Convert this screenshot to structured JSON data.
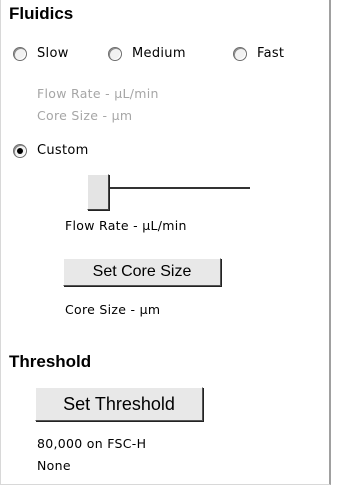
{
  "fluidics": {
    "title": "Fluidics",
    "rate_options": [
      {
        "label": "Slow",
        "selected": false
      },
      {
        "label": "Medium",
        "selected": false
      },
      {
        "label": "Fast",
        "selected": false
      }
    ],
    "preset_flow_rate_text": "Flow Rate - µL/min",
    "preset_core_size_text": "Core Size - µm",
    "custom_option": {
      "label": "Custom",
      "selected": true
    },
    "flow_rate_slider_level": 0,
    "custom_flow_rate_text": "Flow Rate  - µL/min",
    "set_core_size_button": "Set Core Size",
    "custom_core_size_text": "Core Size - µm"
  },
  "threshold": {
    "title": "Threshold",
    "set_threshold_button": "Set Threshold",
    "value_text": "80,000 on FSC-H",
    "secondary_text": "None"
  }
}
